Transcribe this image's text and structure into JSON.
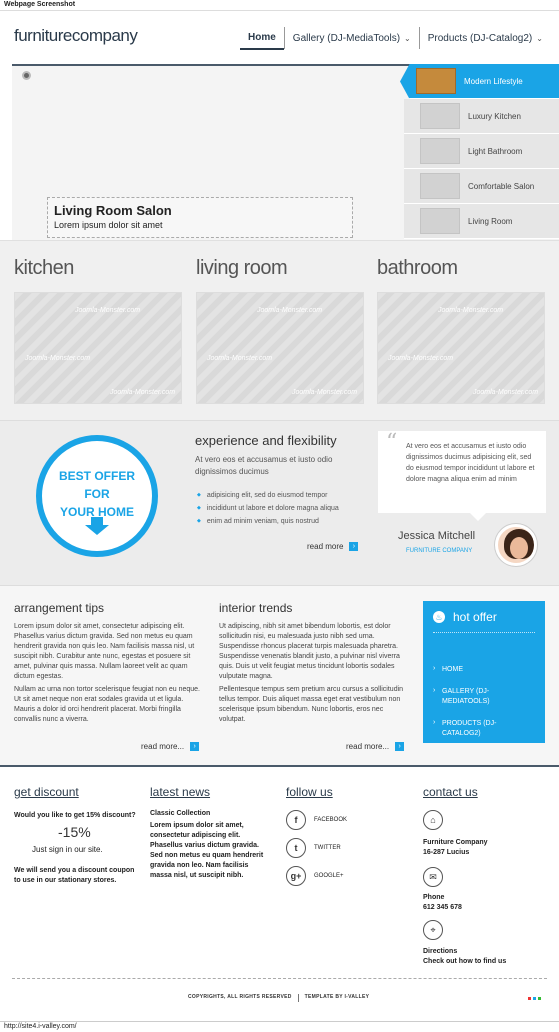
{
  "chrome": {
    "title": "Webpage Screenshot",
    "status_url": "http://site4.i-valley.com/"
  },
  "header": {
    "logo_a": "furniture",
    "logo_b": "company",
    "nav": [
      {
        "label": "Home"
      },
      {
        "label": "Gallery (DJ-MediaTools)"
      },
      {
        "label": "Products (DJ-Catalog2)"
      }
    ]
  },
  "slider": {
    "caption_title": "Living Room Salon",
    "caption_sub": "Lorem ipsum dolor sit amet",
    "thumbs": [
      {
        "label": "Modern Lifestyle"
      },
      {
        "label": "Luxury Kitchen"
      },
      {
        "label": "Light Bathroom"
      },
      {
        "label": "Comfortable Salon"
      },
      {
        "label": "Living Room"
      }
    ]
  },
  "rooms": {
    "items": [
      {
        "title": "kitchen"
      },
      {
        "title": "living room"
      },
      {
        "title": "bathroom"
      }
    ],
    "watermark": "Joomla-Monster.com"
  },
  "offer": {
    "best_1": "BEST OFFER",
    "best_2": "FOR",
    "best_3": "YOUR HOME",
    "exp_title": "experience and flexibility",
    "exp_lead": "At vero eos et accusamus et iusto odio dignissimos ducimus",
    "exp_list": [
      "adipisicing elit, sed do eiusmod tempor",
      "incididunt ut labore et dolore magna aliqua",
      "enim ad minim veniam, quis nostrud"
    ],
    "read_more": "read more",
    "quote": "At vero eos et accusamus et iusto odio dignissimos ducimus adipisicing elit, sed do eiusmod tempor incididunt ut labore et dolore magna aliqua enim ad minim",
    "author_name": "Jessica Mitchell",
    "author_company": "FURNITURE COMPANY"
  },
  "info": {
    "tips_title": "arrangement tips",
    "tips_p1": "Lorem ipsum dolor sit amet, consectetur adipiscing elit. Phasellus varius dictum gravida. Sed non metus eu quam hendrerit gravida non quis leo. Nam facilisis massa nisl, ut suscipit nibh. Curabitur ante nunc, egestas et posuere sit amet, pulvinar quis massa. Nullam laoreet velit ac quam dictum egestas.",
    "tips_p2": "Nullam ac urna non tortor scelerisque feugiat non eu neque. Ut sit amet neque non erat sodales gravida ut et ligula. Mauris a dolor id orci hendrerit placerat. Morbi fringilla convallis nunc a viverra.",
    "trends_title": "interior trends",
    "trends_p1": "Ut adipiscing, nibh sit amet bibendum lobortis, est dolor sollicitudin nisi, eu malesuada justo nibh sed urna. Suspendisse rhoncus placerat turpis malesuada pharetra. Suspendisse venenatis blandit justo, a pulvinar nisl viverra quis. Duis ut velit feugiat metus tincidunt lobortis sodales vulputate magna.",
    "trends_p2": "Pellentesque tempus sem pretium arcu cursus a sollicitudin tellus tempor. Duis aliquet massa eget erat vestibulum non scelerisque ipsum bibendum. Nunc lobortis, eros nec volutpat.",
    "read_more": "read more...",
    "hot_title": "hot offer",
    "hot_items": [
      "HOME",
      "GALLERY (DJ-MEDIATOOLS)",
      "PRODUCTS (DJ-CATALOG2)"
    ]
  },
  "footer": {
    "discount_title": "get discount",
    "discount_q": "Would you like to get 15% discount?",
    "discount_big": "-15%",
    "discount_cta": "Just sign in our site.",
    "discount_note": "We will send you a discount coupon to use in our stationary stores.",
    "news_title": "latest news",
    "news_item_title": "Classic Collection",
    "news_item_text": "Lorem ipsum dolor sit amet, consectetur adipiscing elit. Phasellus varius dictum gravida. Sed non metus eu quam hendrerit gravida non leo. Nam facilisis massa nisl, ut suscipit nibh.",
    "follow_title": "follow us",
    "social": [
      {
        "icon": "facebook-icon",
        "glyph": "f",
        "label": "FACEBOOK"
      },
      {
        "icon": "twitter-icon",
        "glyph": "t",
        "label": "TWITTER"
      },
      {
        "icon": "google-plus-icon",
        "glyph": "g+",
        "label": "GOOGLE+"
      }
    ],
    "contact_title": "contact us",
    "contact_company": "Furniture Company",
    "contact_address": "16-287 Lucius",
    "contact_phone_label": "Phone",
    "contact_phone": "612 345 678",
    "contact_dir_label": "Directions",
    "contact_dir_text": "Check out how to find us",
    "copyright": "COPYRIGHTS, ALL RIGHTS RESERVED",
    "credit": "TEMPLATE BY I-VALLEY"
  },
  "colors": {
    "accent": "#1aa4e6",
    "dark": "#2a3a4a"
  }
}
